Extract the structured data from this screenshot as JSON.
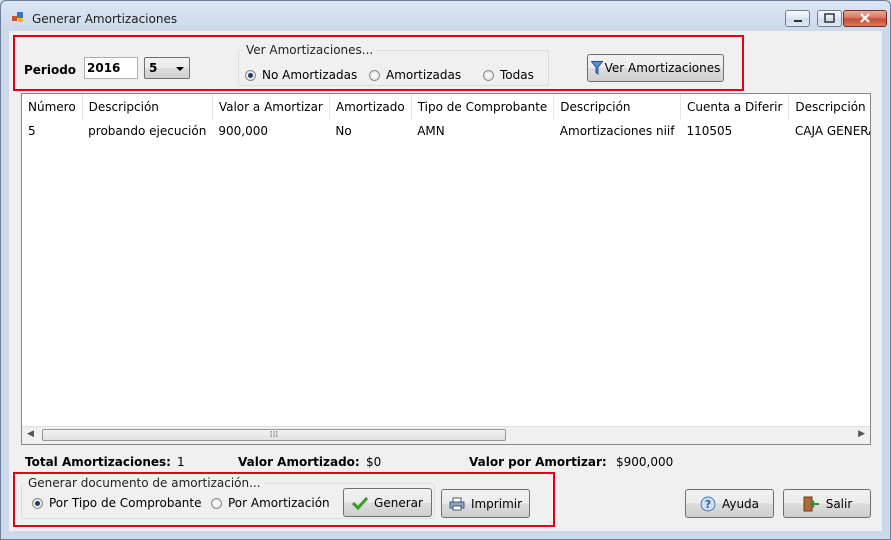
{
  "window": {
    "title": "Generar Amortizaciones"
  },
  "filter": {
    "periodo_label": "Periodo",
    "year_value": "2016",
    "month_value": "5",
    "group_title": "Ver Amortizaciones...",
    "radio_no": "No Amortizadas",
    "radio_si": "Amortizadas",
    "radio_todas": "Todas",
    "ver_button": "Ver Amortizaciones"
  },
  "table": {
    "columns": [
      "Número",
      "Descripción",
      "Valor a Amortizar",
      "Amortizado",
      "Tipo de Comprobante",
      "Descripción",
      "Cuenta a Diferir",
      "Descripción"
    ],
    "rows": [
      [
        "5",
        "probando ejecución",
        "900,000",
        "No",
        "AMN",
        "Amortizaciones niif",
        "110505",
        "CAJA GENERAL"
      ]
    ]
  },
  "summary": {
    "total_label": "Total Amortizaciones:",
    "total_value": "1",
    "amortizado_label": "Valor Amortizado:",
    "amortizado_value": "$0",
    "por_amortizar_label": "Valor por Amortizar:",
    "por_amortizar_value": "$900,000"
  },
  "generate": {
    "group_title": "Generar documento de amortización...",
    "radio_tipo": "Por Tipo de Comprobante",
    "radio_amort": "Por Amortización",
    "generar_button": "Generar",
    "imprimir_button": "Imprimir"
  },
  "footer": {
    "ayuda_button": "Ayuda",
    "salir_button": "Salir"
  },
  "colors": {
    "highlight_border": "#e3001b",
    "radio_selected": "#1b3d6e"
  }
}
